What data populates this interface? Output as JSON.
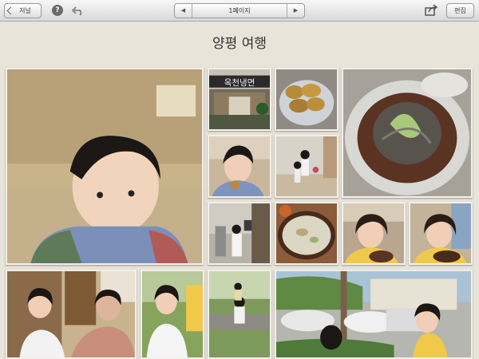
{
  "toolbar": {
    "back_label": "저널",
    "help_icon": "?",
    "undo_icon": "undo-icon",
    "pager_label": "1페이지",
    "prev_icon": "◀",
    "next_icon": "▶",
    "share_icon": "share-icon",
    "edit_label": "편집"
  },
  "journal": {
    "title": "양평 여행"
  },
  "photos": [
    {
      "subject": "boy-portrait"
    },
    {
      "subject": "restaurant-storefront",
      "sign_text": "옥천냉면"
    },
    {
      "subject": "pancakes"
    },
    {
      "subject": "cold-noodles"
    },
    {
      "subject": "boy-eating"
    },
    {
      "subject": "kids-running"
    },
    {
      "subject": "kid-indoors"
    },
    {
      "subject": "soup-bowl"
    },
    {
      "subject": "girl-eating"
    },
    {
      "subject": "girl-eating-2"
    },
    {
      "subject": "boy-and-father"
    },
    {
      "subject": "boy-outdoors"
    },
    {
      "subject": "boy-bench"
    },
    {
      "subject": "parking-lot-girl"
    }
  ]
}
